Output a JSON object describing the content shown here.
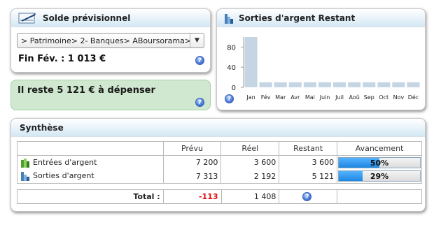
{
  "solde": {
    "title": "Solde prévisionnel",
    "select_value": "> Patrimoine> 2- Banques> ABoursorama>",
    "fin_text": "Fin Fév. : 1 013 €",
    "help": "?"
  },
  "reste": {
    "text": "Il reste 5 121 € à dépenser",
    "help": "?"
  },
  "sorties": {
    "title": "Sorties d'argent Restant",
    "help": "?",
    "bar_color": "#c5d5e3"
  },
  "chart_data": {
    "type": "bar",
    "categories": [
      "Jan",
      "Fév",
      "Mar",
      "Avr",
      "Mai",
      "Juin",
      "Juil",
      "Aoû",
      "Sep",
      "Oct",
      "Nov",
      "Déc"
    ],
    "values": [
      100,
      10,
      10,
      10,
      10,
      10,
      10,
      10,
      10,
      10,
      10,
      10
    ],
    "yticks": [
      "0",
      "40",
      "80"
    ],
    "ylim": [
      0,
      100
    ],
    "title": "",
    "xlabel": "",
    "ylabel": ""
  },
  "synthese": {
    "title": "Synthèse",
    "headers": [
      "",
      "Prévu",
      "Réel",
      "Restant",
      "Avancement"
    ],
    "rows": [
      {
        "label": "Entrées d'argent",
        "prevu": "7 200",
        "reel": "3 600",
        "restant": "3 600",
        "progress_label": "50%",
        "progress": 0.5
      },
      {
        "label": "Sorties d'argent",
        "prevu": "7 313",
        "reel": "2 192",
        "restant": "5 121",
        "progress_label": "29%",
        "progress": 0.29
      }
    ],
    "total": {
      "label": "Total :",
      "prevu": "-113",
      "reel": "1 408",
      "help": "?"
    },
    "accent_negative": "#e01010",
    "progress_color": "#1f86e0"
  }
}
